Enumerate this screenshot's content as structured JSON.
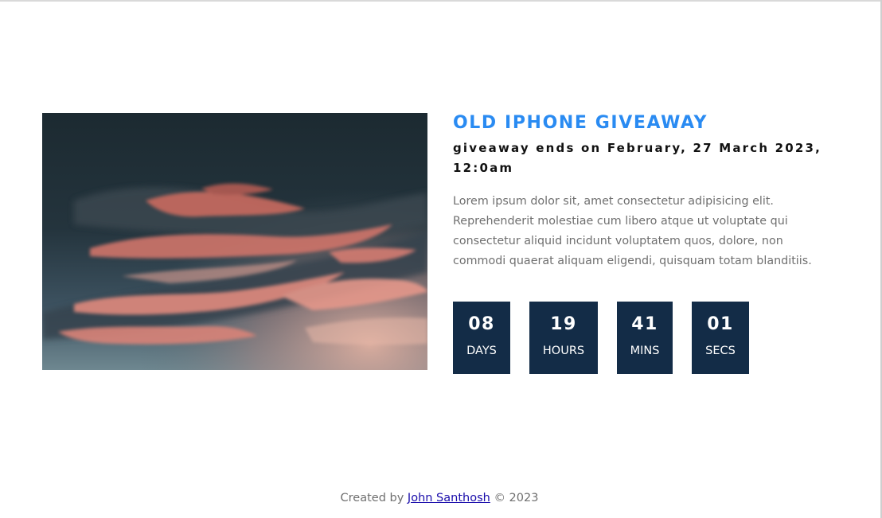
{
  "giveaway": {
    "title": "OLD IPHONE GIVEAWAY",
    "ends_text": "giveaway ends on February, 27 March 2023, 12:0am",
    "description": "Lorem ipsum dolor sit, amet consectetur adipisicing elit. Reprehenderit molestiae cum libero atque ut voluptate qui consectetur aliquid incidunt voluptatem quos, dolore, non commodi quaerat aliquam eligendi, quisquam totam blanditiis."
  },
  "countdown": [
    {
      "value": "08",
      "label": "DAYS"
    },
    {
      "value": "19",
      "label": "HOURS"
    },
    {
      "value": "41",
      "label": "MINS"
    },
    {
      "value": "01",
      "label": "SECS"
    }
  ],
  "footer": {
    "prefix": "Created by",
    "author": "John Santhosh",
    "suffix": "© 2023"
  },
  "colors": {
    "title": "#2a8bf2",
    "countdown_bg": "#132c47",
    "body_text": "#6f6f6f"
  }
}
